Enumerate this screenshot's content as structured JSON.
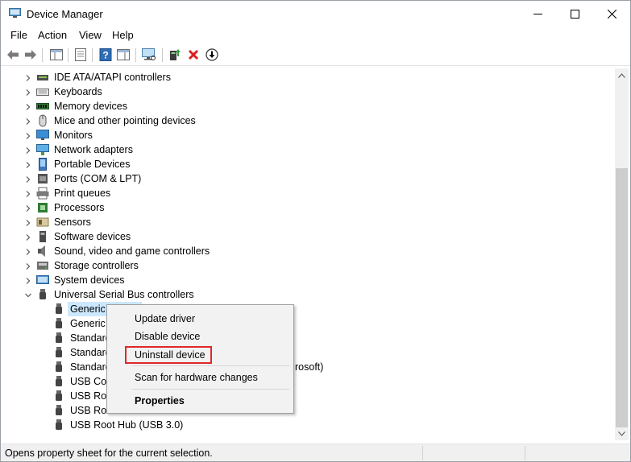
{
  "window": {
    "title": "Device Manager"
  },
  "menu": [
    "File",
    "Action",
    "View",
    "Help"
  ],
  "toolbar_icons": [
    "back-arrow-icon",
    "forward-arrow-icon",
    "show-hide-console-tree-icon",
    "properties-sheet-icon",
    "help-icon",
    "view-pane-icon",
    "scan-hardware-icon",
    "update-driver-icon",
    "uninstall-x-icon",
    "download-driver-icon"
  ],
  "tree": {
    "categories": [
      {
        "label": "IDE ATA/ATAPI controllers",
        "icon": "ide-controller-icon"
      },
      {
        "label": "Keyboards",
        "icon": "keyboard-icon"
      },
      {
        "label": "Memory devices",
        "icon": "memory-icon"
      },
      {
        "label": "Mice and other pointing devices",
        "icon": "mouse-icon"
      },
      {
        "label": "Monitors",
        "icon": "monitor-icon"
      },
      {
        "label": "Network adapters",
        "icon": "network-adapter-icon"
      },
      {
        "label": "Portable Devices",
        "icon": "portable-device-icon"
      },
      {
        "label": "Ports (COM & LPT)",
        "icon": "port-icon"
      },
      {
        "label": "Print queues",
        "icon": "printer-icon"
      },
      {
        "label": "Processors",
        "icon": "processor-icon"
      },
      {
        "label": "Sensors",
        "icon": "sensor-icon"
      },
      {
        "label": "Software devices",
        "icon": "software-device-icon"
      },
      {
        "label": "Sound, video and game controllers",
        "icon": "speaker-icon"
      },
      {
        "label": "Storage controllers",
        "icon": "storage-icon"
      },
      {
        "label": "System devices",
        "icon": "system-device-icon"
      },
      {
        "label": "Universal Serial Bus controllers",
        "icon": "usb-icon"
      }
    ],
    "usb_children": [
      {
        "label": "Generic USB Hub"
      },
      {
        "label": "Generic U"
      },
      {
        "label": "Standard"
      },
      {
        "label": "Standard"
      },
      {
        "label": "Standard",
        "suffix": "rosoft)"
      },
      {
        "label": "USB Com"
      },
      {
        "label": "USB Root"
      },
      {
        "label": "USB Root Hub"
      },
      {
        "label": "USB Root Hub (USB 3.0)"
      }
    ]
  },
  "context_menu": {
    "items": [
      "Update driver",
      "Disable device",
      "Uninstall device",
      "Scan for hardware changes",
      "Properties"
    ],
    "highlighted": "Uninstall device",
    "highlight_color": "#e0282b"
  },
  "status": {
    "text": "Opens property sheet for the current selection."
  },
  "colors": {
    "selection": "#cce8ff",
    "menu_bg": "#f2f2f2"
  }
}
